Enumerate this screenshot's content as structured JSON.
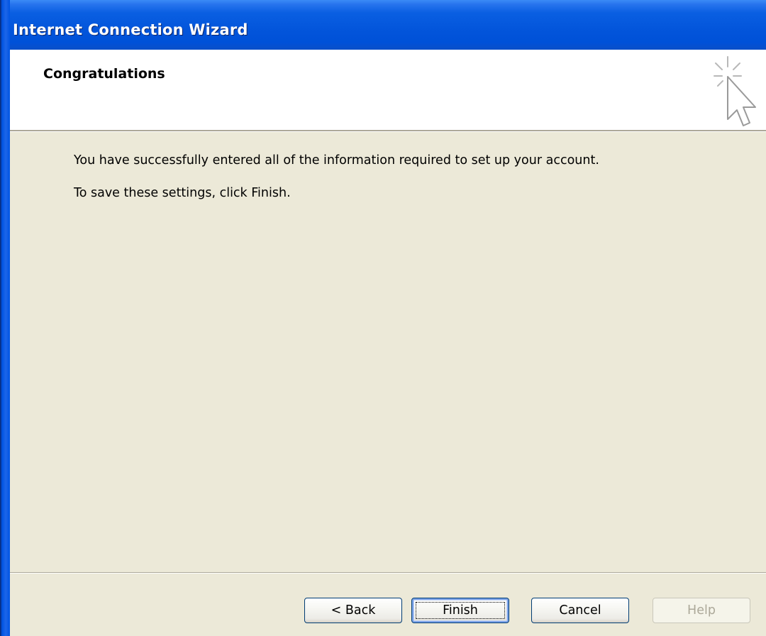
{
  "window": {
    "title": "Internet Connection Wizard"
  },
  "header": {
    "title": "Congratulations",
    "icon": "wizard-cursor-sparkle-icon"
  },
  "content": {
    "line1": "You have successfully entered all of the information required to set up your account.",
    "line2": "To save these settings, click Finish."
  },
  "buttons": {
    "back": "< Back",
    "finish": "Finish",
    "cancel": "Cancel",
    "help": "Help"
  },
  "colors": {
    "title_bar": "#0054e3",
    "dialog_background": "#ece9d8",
    "header_background": "#ffffff",
    "button_border": "#003c74",
    "disabled_text": "#aca899"
  }
}
